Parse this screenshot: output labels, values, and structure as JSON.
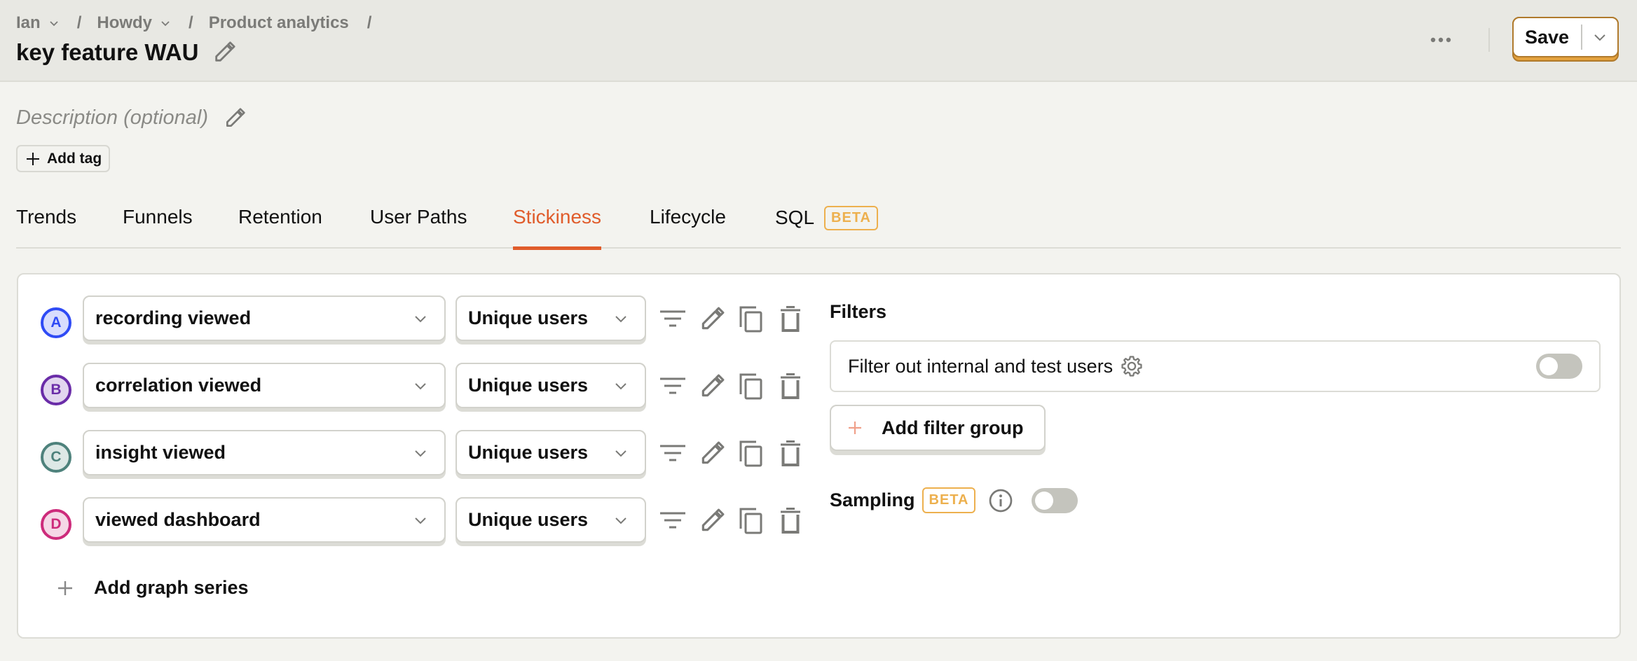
{
  "header": {
    "breadcrumbs": [
      {
        "label": "Ian",
        "has_dropdown": true
      },
      {
        "label": "Howdy",
        "has_dropdown": true
      },
      {
        "label": "Product analytics",
        "has_dropdown": false
      }
    ],
    "separator": "/",
    "title": "key feature WAU",
    "save_label": "Save"
  },
  "description": {
    "placeholder": "Description (optional)",
    "add_tag_label": "Add tag"
  },
  "tabs": [
    {
      "label": "Trends",
      "active": false
    },
    {
      "label": "Funnels",
      "active": false
    },
    {
      "label": "Retention",
      "active": false
    },
    {
      "label": "User Paths",
      "active": false
    },
    {
      "label": "Stickiness",
      "active": true
    },
    {
      "label": "Lifecycle",
      "active": false
    },
    {
      "label": "SQL",
      "active": false,
      "badge": "BETA"
    }
  ],
  "series": [
    {
      "letter": "A",
      "event": "recording viewed",
      "math": "Unique users",
      "color": "#2f4bf5",
      "bg": "#d8ddfd"
    },
    {
      "letter": "B",
      "event": "correlation viewed",
      "math": "Unique users",
      "color": "#6a2ca8",
      "bg": "#e2d6ef"
    },
    {
      "letter": "C",
      "event": "insight viewed",
      "math": "Unique users",
      "color": "#4e827c",
      "bg": "#dde8e6"
    },
    {
      "letter": "D",
      "event": "viewed dashboard",
      "math": "Unique users",
      "color": "#cd2b7b",
      "bg": "#f5d7e6"
    }
  ],
  "add_series_label": "Add graph series",
  "filters": {
    "title": "Filters",
    "test_account_label": "Filter out internal and test users",
    "test_account_enabled": false,
    "add_filter_group_label": "Add filter group"
  },
  "sampling": {
    "label": "Sampling",
    "badge": "BETA",
    "enabled": false
  },
  "colors": {
    "accent": "#e05c2b",
    "beta": "#edb04e",
    "save_border": "#b07a2c"
  }
}
